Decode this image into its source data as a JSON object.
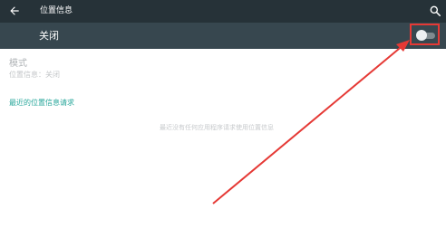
{
  "appbar": {
    "title": "位置信息",
    "back_icon": "arrow-back-icon",
    "search_icon": "search-icon"
  },
  "master_switch": {
    "label": "关闭",
    "state": "off"
  },
  "mode": {
    "title": "模式",
    "value": "位置信息：关闭"
  },
  "recent_requests": {
    "header": "最近的位置信息请求",
    "empty_text": "最近没有任何应用程序请求使用位置信息"
  },
  "colors": {
    "appbar": "#263238",
    "switchbar": "#37474f",
    "accent": "#26a69a",
    "annotation": "#e53935"
  }
}
